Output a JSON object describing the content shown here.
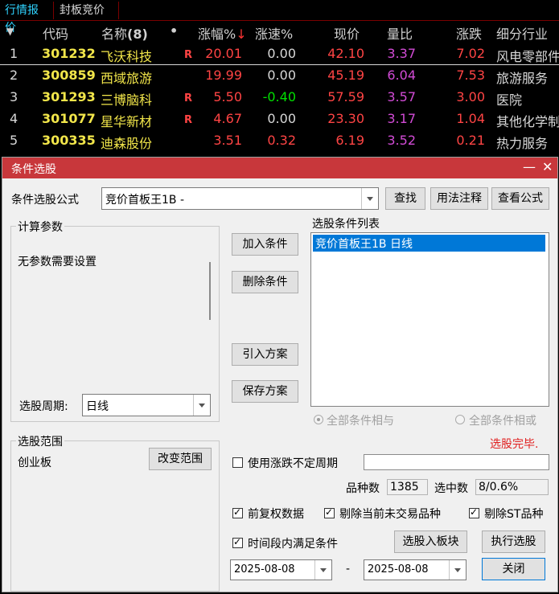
{
  "tabs": [
    "行情报价",
    "封板竞价"
  ],
  "quote_header": {
    "arrow": "▼",
    "code": "代码",
    "name": "名称",
    "count": "(8)",
    "dot": "•",
    "change_pct": "涨幅%",
    "sort_arrow": "↓",
    "speed": "涨速%",
    "price": "现价",
    "vol_ratio": "量比",
    "change": "涨跌",
    "industry": "细分行业"
  },
  "rows": [
    {
      "idx": "1",
      "code": "301232",
      "name": "飞沃科技",
      "flag": "R",
      "change_pct": "20.01",
      "speed": "0.00",
      "price": "42.10",
      "vol_ratio": "3.37",
      "change": "7.02",
      "industry": "风电零部件"
    },
    {
      "idx": "2",
      "code": "300859",
      "name": "西域旅游",
      "flag": "",
      "change_pct": "19.99",
      "speed": "0.00",
      "price": "45.19",
      "vol_ratio": "6.04",
      "change": "7.53",
      "industry": "旅游服务"
    },
    {
      "idx": "3",
      "code": "301293",
      "name": "三博脑科",
      "flag": "R",
      "change_pct": "5.50",
      "speed": "-0.40",
      "price": "57.59",
      "vol_ratio": "3.57",
      "change": "3.00",
      "industry": "医院"
    },
    {
      "idx": "4",
      "code": "301077",
      "name": "星华新材",
      "flag": "R",
      "change_pct": "4.67",
      "speed": "0.00",
      "price": "23.30",
      "vol_ratio": "3.17",
      "change": "1.04",
      "industry": "其他化学制品"
    },
    {
      "idx": "5",
      "code": "300335",
      "name": "迪森股份",
      "flag": "",
      "change_pct": "3.51",
      "speed": "0.32",
      "price": "6.19",
      "vol_ratio": "3.52",
      "change": "0.21",
      "industry": "热力服务"
    }
  ],
  "dialog": {
    "title": "条件选股",
    "minimize": "—",
    "close": "✕",
    "formula_label": "条件选股公式",
    "formula_value": "竞价首板王1B  -",
    "find": "查找",
    "usage": "用法注释",
    "view_formula": "查看公式",
    "params_title": "计算参数",
    "no_params": "无参数需要设置",
    "period_label": "选股周期:",
    "period_value": "日线",
    "add_cond": "加入条件",
    "del_cond": "删除条件",
    "import_plan": "引入方案",
    "save_plan": "保存方案",
    "list_title": "选股条件列表",
    "list_items": [
      "竞价首板王1B  日线"
    ],
    "radio_and": "全部条件相与",
    "radio_or": "全部条件相或",
    "status": "选股完毕.",
    "range_title": "选股范围",
    "range_value": "创业板",
    "change_range": "改变范围",
    "use_uncertain_period": "使用涨跌不定周期",
    "count_label": "品种数",
    "count_value": "1385",
    "selected_label": "选中数",
    "selected_value": "8/0.6%",
    "forward_adj": "前复权数据",
    "exclude_untraded": "剔除当前未交易品种",
    "exclude_st": "剔除ST品种",
    "time_period": "时间段内满足条件",
    "to_block": "选股入板块",
    "execute": "执行选股",
    "date_from": "2025-08-08",
    "date_sep": "-",
    "date_to": "2025-08-08",
    "close_btn": "关闭"
  },
  "colors": {
    "code": "#f2e64a",
    "name": "#f2e64a",
    "up": "#ff4444",
    "down": "#00e000",
    "flat": "#d8d8d8",
    "vol_ratio": "#d24bd6",
    "tab_active": "#2fd3ff",
    "dialog_title": "#c8373b",
    "status": "#e02020"
  }
}
